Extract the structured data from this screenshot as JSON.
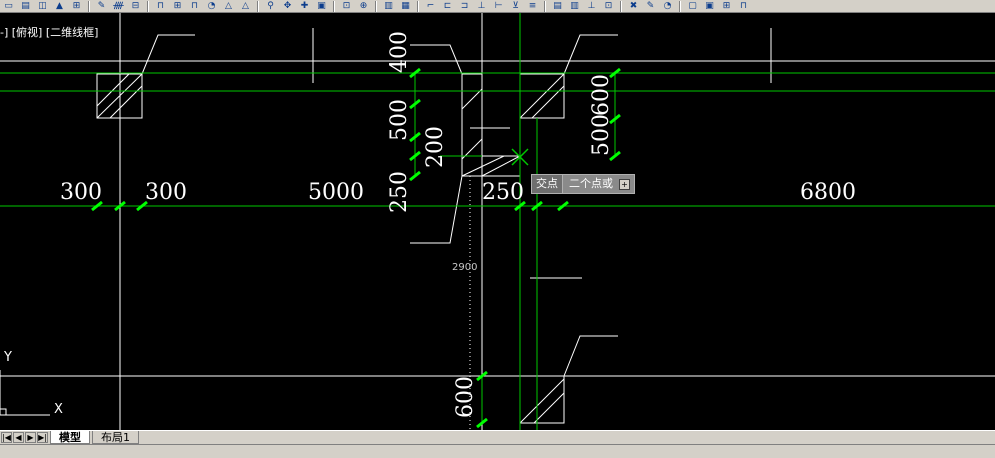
{
  "viewport_label": "-] [俯视] [二维线框]",
  "dimensions": {
    "d300_left": "300",
    "d300_right": "300",
    "d5000": "5000",
    "d250_h": "250",
    "d6800": "6800",
    "d400": "400",
    "d500_left": "500",
    "d200": "200",
    "d250_v": "250",
    "d600_top": "600",
    "d500_right": "500",
    "d600_bottom": "600",
    "tracking_value": "2900"
  },
  "tooltip": {
    "label": "交点",
    "text": "二个点或",
    "button": "+"
  },
  "ucs": {
    "x": "X",
    "y": "Y"
  },
  "tabs": [
    {
      "label": "模型",
      "active": true
    },
    {
      "label": "布局1",
      "active": false
    }
  ],
  "nav_buttons": [
    "|◀",
    "◀",
    "▶",
    "▶|"
  ],
  "colors": {
    "background": "#000000",
    "dim_green": "#00ff00",
    "line_white": "#ffffff",
    "line_green": "#00c800"
  }
}
